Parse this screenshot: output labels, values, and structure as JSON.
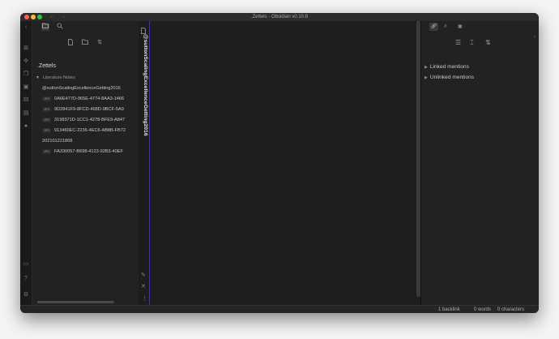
{
  "window": {
    "title": ".Zettels - Obsidian v0.10.8"
  },
  "sidebar": {
    "vault_name": ".Zettels",
    "folder_label": "Literature Notes",
    "items": [
      {
        "label": "@suttonScalingExcellenceGetting2016",
        "badge": ""
      },
      {
        "label": "0A6E477D-965E-4774-8AA3-1466",
        "badge": "JPG"
      },
      {
        "label": "9D2841F9-8FCD-468D-9BCF-5A9",
        "badge": "JPG"
      },
      {
        "label": "3198371D-1CC1-4278-BFE9-A847",
        "badge": "JPG"
      },
      {
        "label": "913460EC-2236-4EC6-AB8B-FB72",
        "badge": "JPG"
      },
      {
        "label": "202101221808",
        "badge": ""
      },
      {
        "label": "FA330057-B698-4123-92B3-40EF",
        "badge": "JPG"
      }
    ]
  },
  "pane": {
    "title": "@suttonScalingExcellenceGetting2016"
  },
  "backlinks": {
    "linked_label": "Linked mentions",
    "unlinked_label": "Unlinked mentions"
  },
  "status": {
    "backlinks": "1 backlink",
    "words": "0 words",
    "characters": "0 characters"
  },
  "colors": {
    "accent": "#3a3a9a",
    "close": "#ff5f57",
    "minimize": "#febc2e",
    "zoom": "#28c840"
  }
}
